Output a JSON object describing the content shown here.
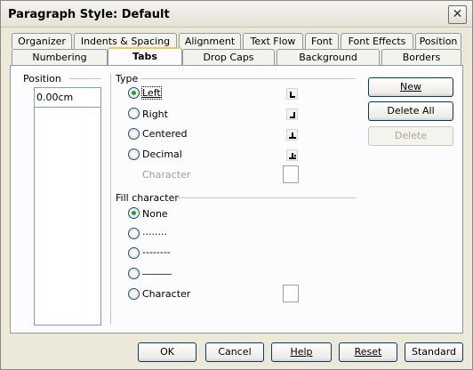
{
  "window": {
    "title": "Paragraph Style: Default",
    "close_glyph": "✕"
  },
  "tabs": {
    "row1": [
      "Organizer",
      "Indents & Spacing",
      "Alignment",
      "Text Flow",
      "Font",
      "Font Effects",
      "Position"
    ],
    "row2": [
      "Numbering",
      "Tabs",
      "Drop Caps",
      "Background",
      "Borders"
    ],
    "active": "Tabs"
  },
  "position": {
    "label": "Position",
    "value": "0.00cm"
  },
  "type": {
    "label": "Type",
    "options": [
      "Left",
      "Right",
      "Centered",
      "Decimal"
    ],
    "selected": "Left",
    "character_label": "Character"
  },
  "fill": {
    "label": "Fill character",
    "options": [
      "None",
      "........",
      "--------",
      "______",
      "Character"
    ],
    "selected": "None"
  },
  "side_buttons": {
    "new": "New",
    "delete_all": "Delete All",
    "delete": "Delete"
  },
  "footer": {
    "ok": "OK",
    "cancel": "Cancel",
    "help": "Help",
    "reset": "Reset",
    "standard": "Standard"
  },
  "icons": [
    "close-icon",
    "tab-left-icon",
    "tab-right-icon",
    "tab-center-icon",
    "tab-decimal-icon"
  ]
}
